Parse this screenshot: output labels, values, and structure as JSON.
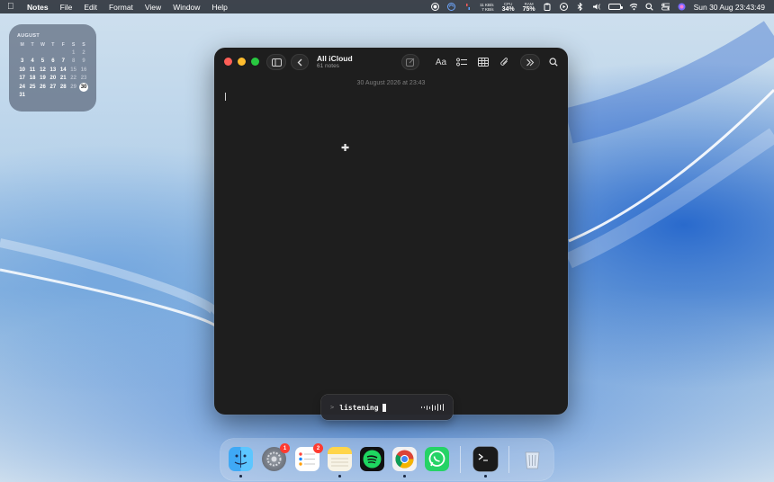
{
  "menubar": {
    "app_name": "Notes",
    "items": [
      "File",
      "Edit",
      "Format",
      "View",
      "Window",
      "Help"
    ],
    "net_up": "11 KB/s",
    "net_down": "7 KB/s",
    "cpu_label": "CPU",
    "cpu_value": "34%",
    "ram_label": "RAM",
    "ram_value": "75%",
    "datetime": "Sun 30 Aug  23:43:49"
  },
  "calendar": {
    "month": "AUGUST",
    "weekdays": [
      "M",
      "T",
      "W",
      "T",
      "F",
      "S",
      "S"
    ],
    "today": "30"
  },
  "notes": {
    "folder_title": "All iCloud",
    "note_count": "61 notes",
    "note_date": "30 August 2026 at 23:43",
    "format_label": "Aa"
  },
  "listening": {
    "prompt": ">",
    "text": "listening"
  },
  "dock": {
    "settings_badge": "1",
    "reminders_badge": "2"
  },
  "colors": {
    "accent_red": "#fe5f57",
    "accent_yellow": "#febc2e",
    "accent_green": "#28c840",
    "window_bg": "#1e1e1e"
  }
}
